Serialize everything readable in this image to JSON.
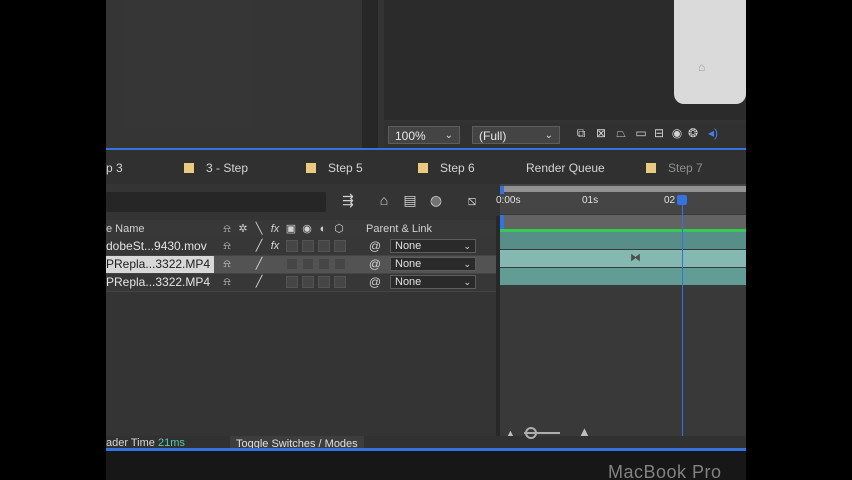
{
  "viewer": {
    "zoom": "100%",
    "resolution": "(Full)"
  },
  "tabs": [
    {
      "label": "p 3"
    },
    {
      "label": "3 - Step"
    },
    {
      "label": "Step 5"
    },
    {
      "label": "Step 6"
    },
    {
      "label": "Render Queue"
    },
    {
      "label": "Step 7"
    }
  ],
  "columns": {
    "name": "e Name",
    "parent": "Parent & Link"
  },
  "timeline": {
    "ticks": [
      "0:00s",
      "01s",
      "02"
    ]
  },
  "layers": [
    {
      "name": "dobeSt...9430.mov",
      "parent": "None",
      "fx": true,
      "selected": false
    },
    {
      "name": "PRepla...3322.MP4",
      "parent": "None",
      "fx": false,
      "selected": true
    },
    {
      "name": "PRepla...3322.MP4",
      "parent": "None",
      "fx": false,
      "selected": false
    }
  ],
  "footer": {
    "render_label": "ader Time",
    "render_value": "21ms",
    "toggle": "Toggle Switches / Modes"
  },
  "device": {
    "brand": "MacBook Pro"
  },
  "colors": {
    "accent_blue": "#2b6be0",
    "tab_swatch": "#e9c77a",
    "green_bar": "#28c846",
    "render_value": "#4ec9a8"
  },
  "icons": [
    "shy-icon",
    "collapse-icon",
    "quality-icon",
    "fx-icon",
    "motion-blur-icon",
    "adjustment-icon",
    "3d-icon",
    "pickwhip-icon",
    "chevron-down-icon"
  ]
}
